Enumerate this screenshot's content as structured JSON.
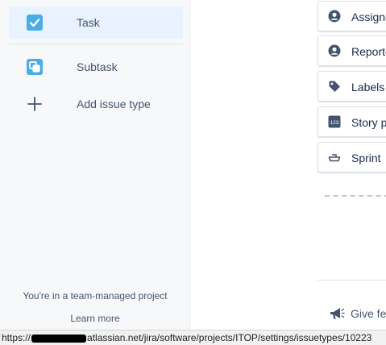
{
  "sidebar": {
    "items": [
      {
        "label": "Task",
        "icon": "task-checkbox-icon",
        "selected": true
      },
      {
        "label": "Subtask",
        "icon": "subtask-icon",
        "selected": false
      },
      {
        "label": "Add issue type",
        "icon": "plus-icon",
        "selected": false
      }
    ],
    "footer_text": "You're in a team-managed project",
    "learn_more": "Learn more"
  },
  "fields": [
    {
      "label": "Assigne",
      "icon": "person-icon"
    },
    {
      "label": "Reporte",
      "icon": "person-icon"
    },
    {
      "label": "Labels",
      "icon": "tag-icon"
    },
    {
      "label": "Story p",
      "icon": "story-points-icon",
      "icon_text": "123"
    },
    {
      "label": "Sprint",
      "icon": "sprint-icon"
    }
  ],
  "feedback": {
    "label": "Give fee",
    "icon": "megaphone-icon"
  },
  "statusbar": {
    "url_prefix": "https://",
    "url_suffix": "atlassian.net/jira/software/projects/ITOP/settings/issuetypes/10223"
  },
  "colors": {
    "accent_blue": "#4bade8",
    "selected_bg": "#e9f2ff",
    "sidebar_bg": "#f7f8f9"
  }
}
